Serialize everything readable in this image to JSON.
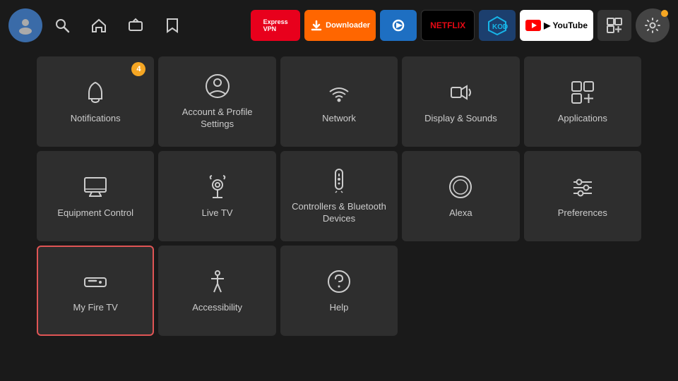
{
  "topbar": {
    "nav_items": [
      {
        "name": "avatar",
        "icon": "👤"
      },
      {
        "name": "search",
        "icon": "🔍"
      },
      {
        "name": "home",
        "icon": "🏠"
      },
      {
        "name": "live-tv-nav",
        "icon": "📺"
      },
      {
        "name": "bookmark",
        "icon": "🔖"
      }
    ],
    "apps": [
      {
        "name": "expressvpn",
        "label": "Express VPN",
        "style": "app-expressvpn"
      },
      {
        "name": "downloader",
        "label": "Downloader",
        "style": "app-downloader"
      },
      {
        "name": "firetv-app",
        "label": "▶",
        "style": "app-blue"
      },
      {
        "name": "netflix",
        "label": "NETFLIX",
        "style": "app-netflix"
      },
      {
        "name": "kodi",
        "label": "⬡",
        "style": "app-kodi"
      },
      {
        "name": "youtube",
        "label": "▶ YouTube",
        "style": "app-youtube"
      },
      {
        "name": "app-grid",
        "label": "⊞",
        "style": "app-grid"
      }
    ],
    "settings_icon": "⚙"
  },
  "grid": {
    "tiles": [
      {
        "name": "notifications",
        "label": "Notifications",
        "icon": "bell",
        "badge": "4",
        "row": 1
      },
      {
        "name": "account-profile",
        "label": "Account & Profile Settings",
        "icon": "person-circle",
        "row": 1
      },
      {
        "name": "network",
        "label": "Network",
        "icon": "wifi",
        "row": 1
      },
      {
        "name": "display-sounds",
        "label": "Display & Sounds",
        "icon": "speaker",
        "row": 1
      },
      {
        "name": "applications",
        "label": "Applications",
        "icon": "app-grid",
        "row": 1
      },
      {
        "name": "equipment-control",
        "label": "Equipment Control",
        "icon": "monitor",
        "row": 2
      },
      {
        "name": "live-tv",
        "label": "Live TV",
        "icon": "antenna",
        "row": 2
      },
      {
        "name": "controllers-bluetooth",
        "label": "Controllers & Bluetooth Devices",
        "icon": "remote",
        "row": 2
      },
      {
        "name": "alexa",
        "label": "Alexa",
        "icon": "alexa",
        "row": 2
      },
      {
        "name": "preferences",
        "label": "Preferences",
        "icon": "sliders",
        "row": 2
      },
      {
        "name": "my-fire-tv",
        "label": "My Fire TV",
        "icon": "fire-tv",
        "row": 3,
        "selected": true
      },
      {
        "name": "accessibility",
        "label": "Accessibility",
        "icon": "accessibility",
        "row": 3
      },
      {
        "name": "help",
        "label": "Help",
        "icon": "help-circle",
        "row": 3
      }
    ]
  }
}
